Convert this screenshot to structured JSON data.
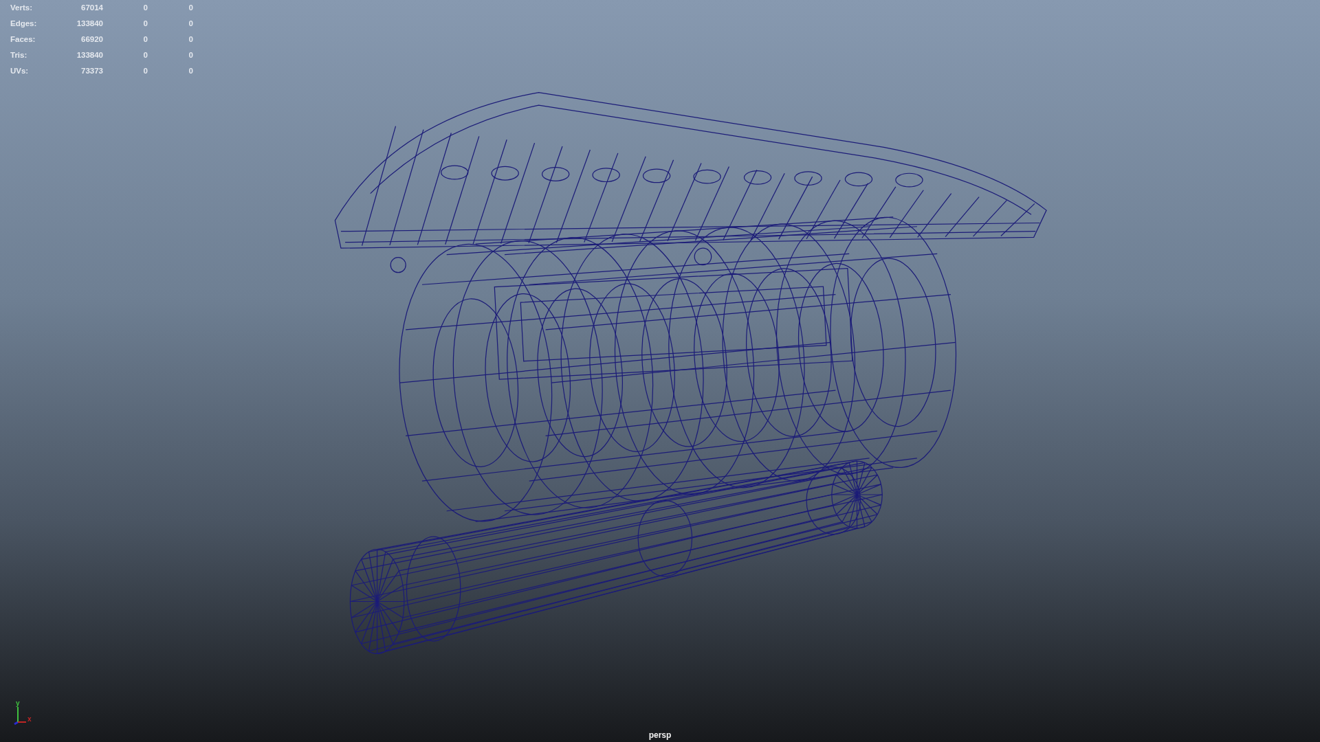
{
  "viewport": {
    "camera": "persp",
    "hud": [
      {
        "label": "Verts:",
        "values": [
          "67014",
          "0",
          "0"
        ]
      },
      {
        "label": "Edges:",
        "values": [
          "133840",
          "0",
          "0"
        ]
      },
      {
        "label": "Faces:",
        "values": [
          "66920",
          "0",
          "0"
        ]
      },
      {
        "label": "Tris:",
        "values": [
          "133840",
          "0",
          "0"
        ]
      },
      {
        "label": "UVs:",
        "values": [
          "73373",
          "0",
          "0"
        ]
      }
    ],
    "axes": [
      {
        "kind": "y",
        "label": "y"
      },
      {
        "kind": "x",
        "label": "x"
      }
    ]
  }
}
